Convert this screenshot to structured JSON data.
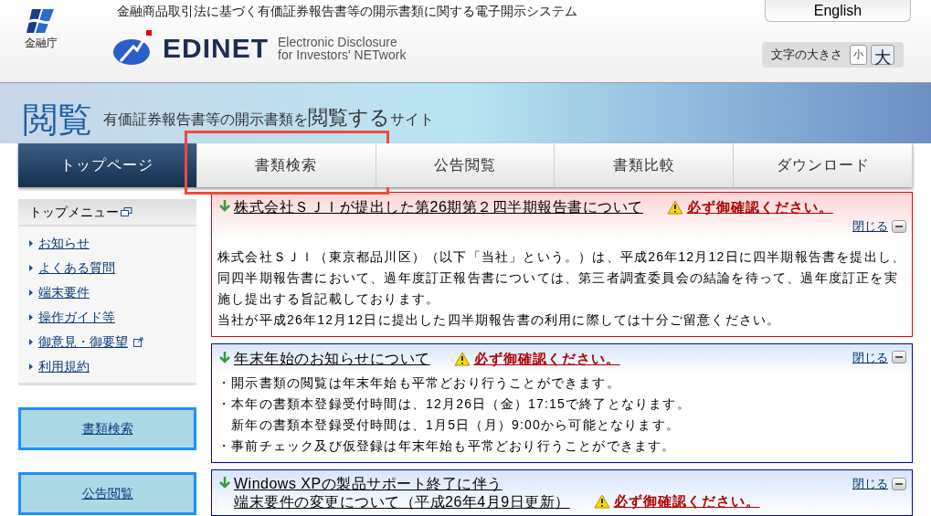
{
  "header": {
    "agency": "金融庁",
    "tagline": "金融商品取引法に基づく有価証券報告書等の開示書類に関する電子開示システム",
    "logo_text": "EDINET",
    "logo_sub": [
      "Electronic Disclosure",
      "for Investors' NETwork"
    ],
    "language_tab": "English",
    "font_size": {
      "label": "文字の大きさ",
      "options": [
        {
          "label": "小",
          "selected": false
        },
        {
          "label": "大",
          "selected": true
        }
      ]
    }
  },
  "banner": {
    "big": "閲覧",
    "text": "有価証券報告書等の開示書類を",
    "emph": "閲覧する",
    "tail": "サイト"
  },
  "nav": [
    {
      "label": "トップページ",
      "selected": true,
      "highlighted": false
    },
    {
      "label": "書類検索",
      "selected": false,
      "highlighted": true
    },
    {
      "label": "公告閲覧",
      "selected": false,
      "highlighted": false
    },
    {
      "label": "書類比較",
      "selected": false,
      "highlighted": false
    },
    {
      "label": "ダウンロード",
      "selected": false,
      "highlighted": false
    }
  ],
  "sidebar": {
    "title": "トップメニュー",
    "items": [
      {
        "label": "お知らせ",
        "external": false
      },
      {
        "label": "よくある質問",
        "external": false
      },
      {
        "label": "端末要件",
        "external": false
      },
      {
        "label": "操作ガイド等",
        "external": false
      },
      {
        "label": "御意見・御要望",
        "external": true
      },
      {
        "label": "利用規約",
        "external": false
      }
    ],
    "buttons": [
      "書類検索",
      "公告閲覧"
    ]
  },
  "notices": [
    {
      "kind": "important",
      "title": [
        "株式会社ＳＪＩが提出した第26期第２四半期報告書について"
      ],
      "warning": "必ず御確認ください。",
      "close": "閉じる",
      "body": [
        "株式会社ＳＪＩ（東京都品川区）（以下「当社」という。）は、平成26年12月12日に四半期報告書を提出し、同四半期報告書において、過年度訂正報告書については、第三者調査委員会の結論を待って、過年度訂正を実施し提出する旨記載しております。",
        "当社が平成26年12月12日に提出した四半期報告書の利用に際しては十分ご留意ください。"
      ]
    },
    {
      "kind": "notice",
      "title": [
        "年末年始のお知らせについて"
      ],
      "warning": "必ず御確認ください。",
      "close": "閉じる",
      "body": [
        "・開示書類の閲覧は年末年始も平常どおり行うことができます。",
        "・本年の書類本登録受付時間は、12月26日（金）17:15で終了となります。",
        "　新年の書類本登録受付時間は、1月5日（月）9:00から可能となります。",
        "・事前チェック及び仮登録は年末年始も平常どおり行うことができます。"
      ]
    },
    {
      "kind": "notice",
      "title": [
        "Windows XPの製品サポート終了に伴う",
        "端末要件の変更について（平成26年4月9日更新）"
      ],
      "warning": "必ず御確認ください。",
      "close": "閉じる"
    }
  ]
}
